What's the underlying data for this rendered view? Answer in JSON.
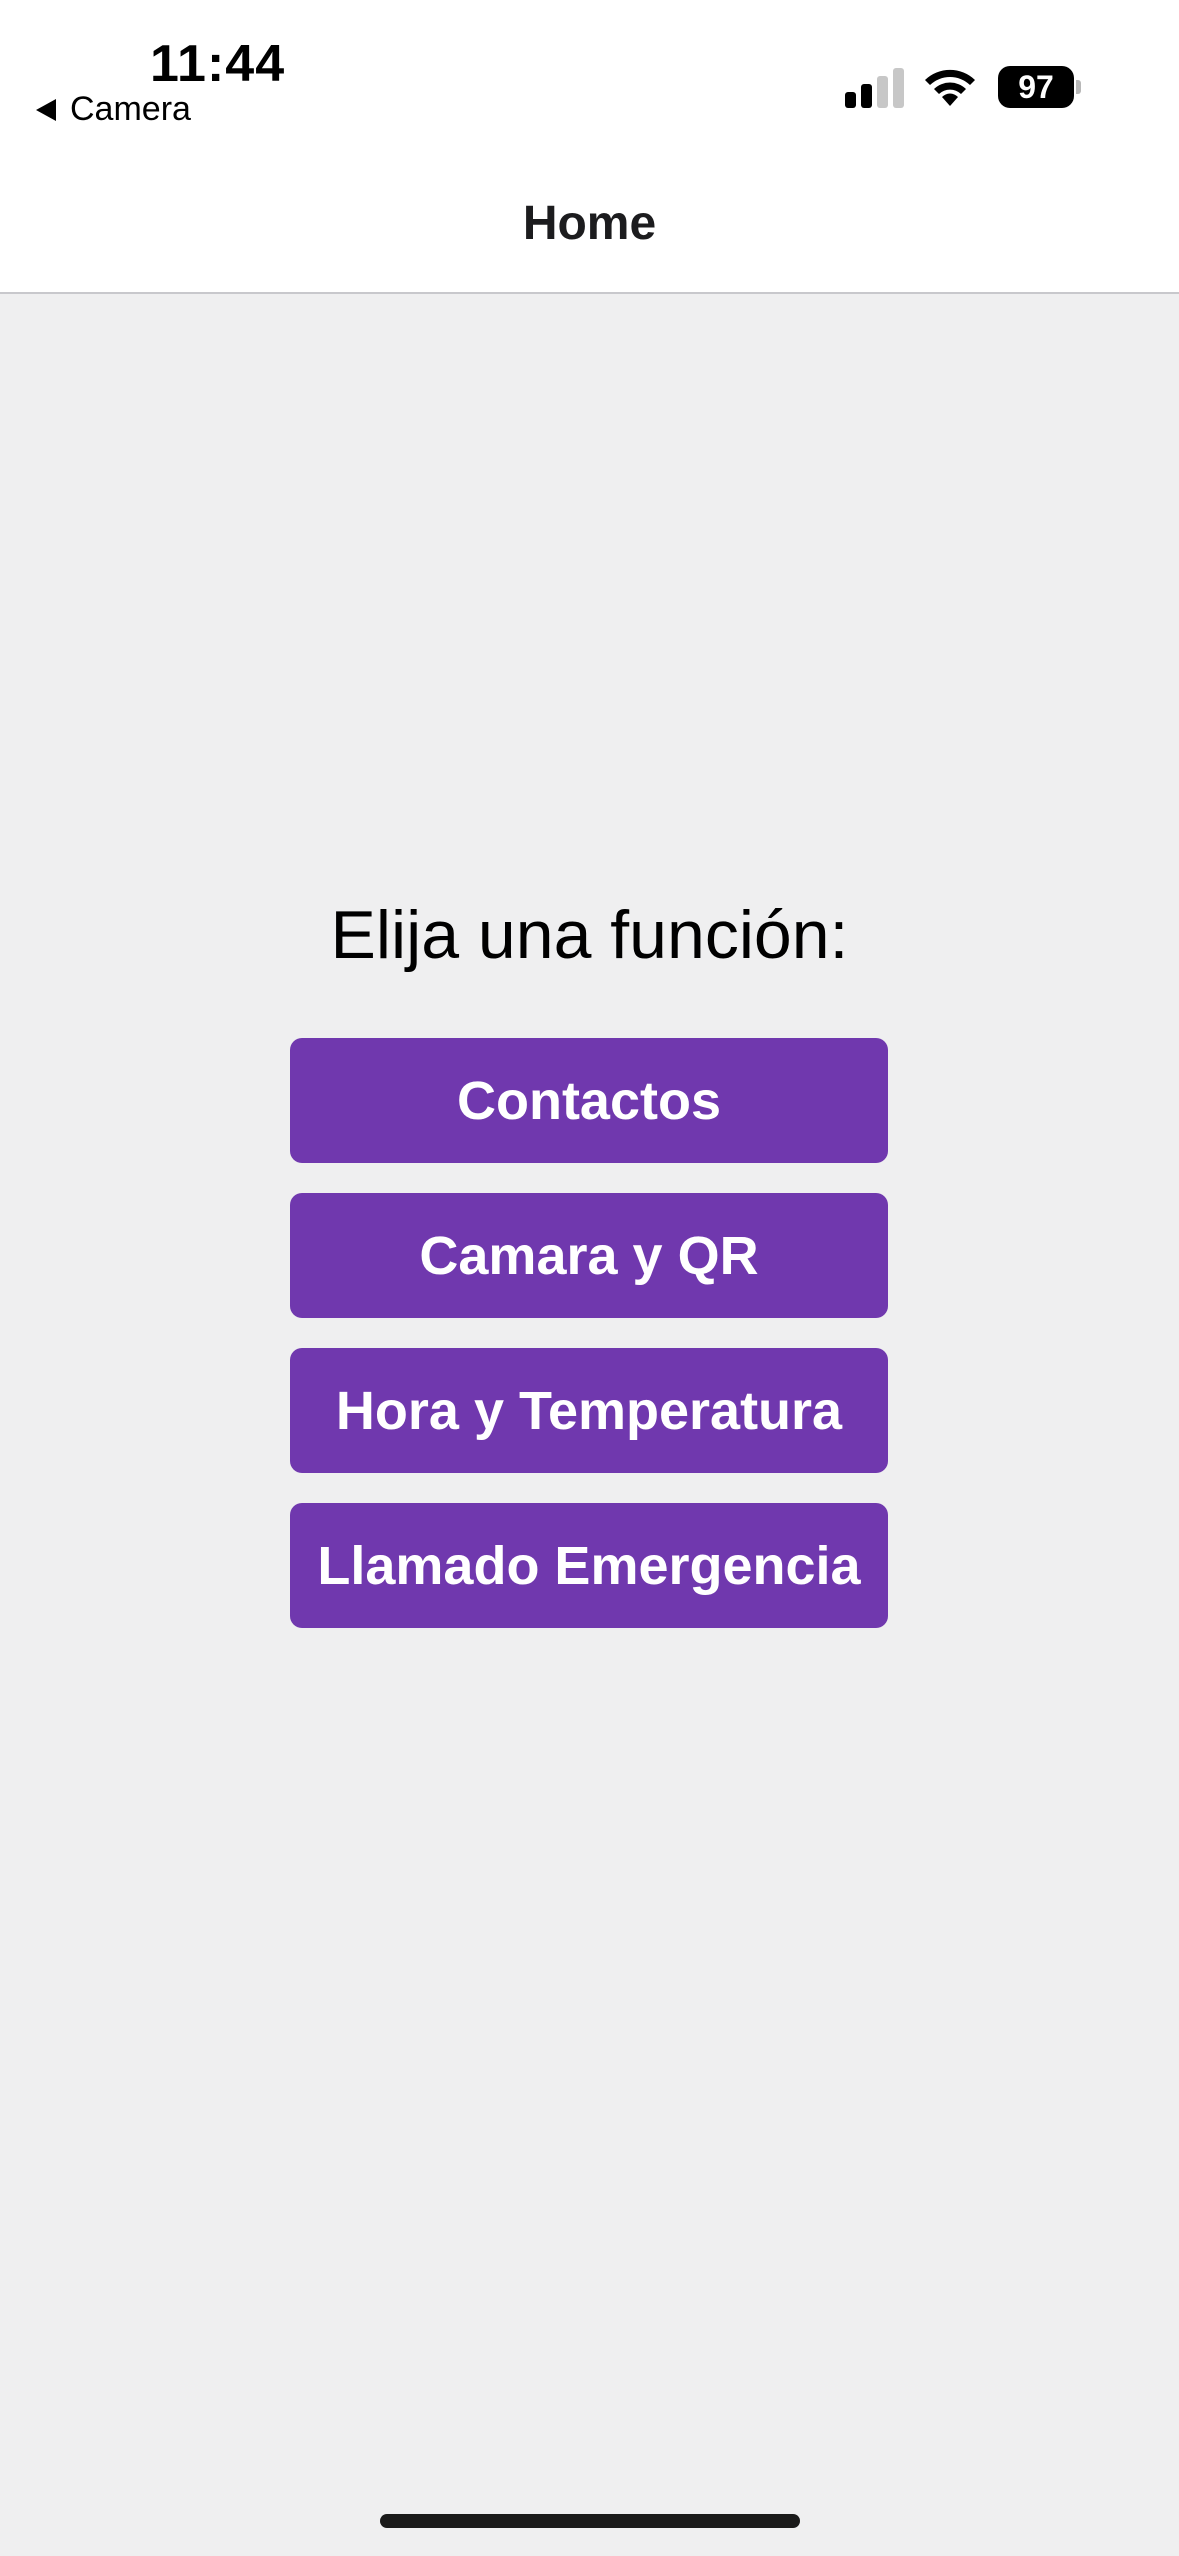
{
  "status_bar": {
    "time": "11:44",
    "back_app_label": "Camera",
    "battery_level": "97",
    "signal_bars_active": 2,
    "signal_bars_total": 4
  },
  "nav": {
    "title": "Home"
  },
  "main": {
    "prompt": "Elija una función:",
    "buttons": [
      {
        "label": "Contactos"
      },
      {
        "label": "Camara y QR"
      },
      {
        "label": "Hora y Temperatura"
      },
      {
        "label": "Llamado Emergencia"
      }
    ]
  },
  "colors": {
    "accent": "#7038ae",
    "background": "#efeff0",
    "bar_background": "#ffffff"
  },
  "icons": {
    "back": "back-caret-icon",
    "signal": "cellular-signal-icon",
    "wifi": "wifi-icon",
    "battery": "battery-icon"
  }
}
